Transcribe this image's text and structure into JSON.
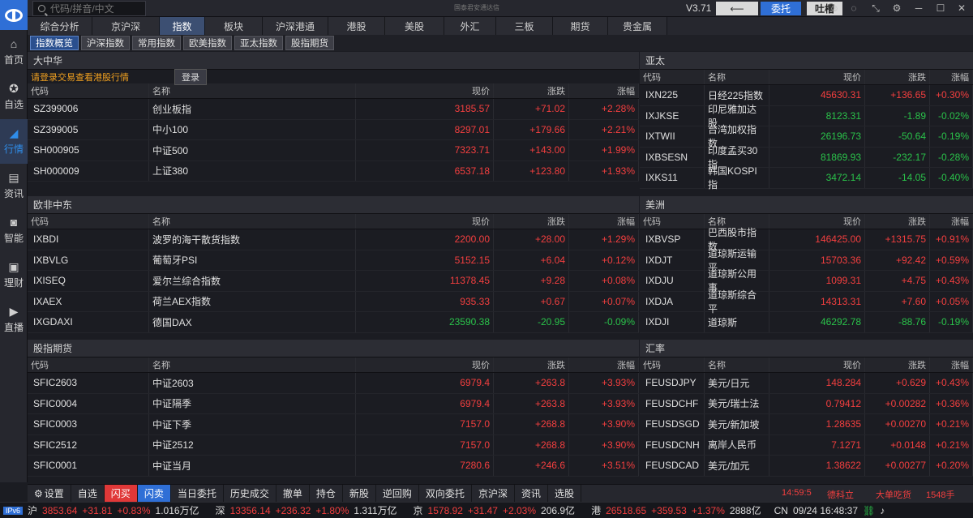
{
  "app": {
    "title_small": "国泰君安通达信",
    "version": "V3.71",
    "back_label": "",
    "entrust_label": "委托",
    "roast_label": "吐槽"
  },
  "search": {
    "placeholder": "代码/拼音/中文"
  },
  "sidebar": {
    "items": [
      {
        "label": "首页",
        "icon": "home-icon",
        "active": false
      },
      {
        "label": "自选",
        "icon": "star-icon",
        "active": false
      },
      {
        "label": "行情",
        "icon": "chart-icon",
        "active": true
      },
      {
        "label": "资讯",
        "icon": "news-icon",
        "active": false
      },
      {
        "label": "智能",
        "icon": "robot-icon",
        "active": false
      },
      {
        "label": "理财",
        "icon": "wallet-icon",
        "active": false
      },
      {
        "label": "直播",
        "icon": "video-icon",
        "active": false
      }
    ]
  },
  "nav": {
    "tabs": [
      {
        "label": "综合分析",
        "w": 80
      },
      {
        "label": "京沪深",
        "w": 83
      },
      {
        "label": "指数",
        "w": 56,
        "active": true
      },
      {
        "label": "板块",
        "w": 71
      },
      {
        "label": "沪深港通",
        "w": 81
      },
      {
        "label": "港股",
        "w": 70
      },
      {
        "label": "美股",
        "w": 73
      },
      {
        "label": "外汇",
        "w": 64
      },
      {
        "label": "三板",
        "w": 70
      },
      {
        "label": "期货",
        "w": 68
      },
      {
        "label": "贵金属",
        "w": 73
      }
    ]
  },
  "subtabs": [
    "指数概览",
    "沪深指数",
    "常用指数",
    "欧美指数",
    "亚太指数",
    "股指期货"
  ],
  "columns": {
    "code": "代码",
    "name": "名称",
    "price": "现价",
    "change": "涨跌",
    "pct": "涨幅"
  },
  "notice": {
    "text": "请登录交易查看港股行情",
    "login": "登录"
  },
  "panels": {
    "greater_china": {
      "title": "大中华",
      "rows": [
        {
          "code": "SZ399006",
          "name": "创业板指",
          "price": "3185.57",
          "change": "+71.02",
          "pct": "+2.28%",
          "dir": "up"
        },
        {
          "code": "SZ399005",
          "name": "中小100",
          "price": "8297.01",
          "change": "+179.66",
          "pct": "+2.21%",
          "dir": "up"
        },
        {
          "code": "SH000905",
          "name": "中证500",
          "price": "7323.71",
          "change": "+143.00",
          "pct": "+1.99%",
          "dir": "up"
        },
        {
          "code": "SH000009",
          "name": "上证380",
          "price": "6537.18",
          "change": "+123.80",
          "pct": "+1.93%",
          "dir": "up"
        }
      ]
    },
    "asia_pacific": {
      "title": "亚太",
      "rows": [
        {
          "code": "IXN225",
          "name": "日经225指数",
          "price": "45630.31",
          "change": "+136.65",
          "pct": "+0.30%",
          "dir": "up"
        },
        {
          "code": "IXJKSE",
          "name": "印尼雅加达股",
          "price": "8123.31",
          "change": "-1.89",
          "pct": "-0.02%",
          "dir": "down"
        },
        {
          "code": "IXTWII",
          "name": "台湾加权指数",
          "price": "26196.73",
          "change": "-50.64",
          "pct": "-0.19%",
          "dir": "down"
        },
        {
          "code": "IXBSESN",
          "name": "印度孟买30指",
          "price": "81869.93",
          "change": "-232.17",
          "pct": "-0.28%",
          "dir": "down"
        },
        {
          "code": "IXKS11",
          "name": "韩国KOSPI指",
          "price": "3472.14",
          "change": "-14.05",
          "pct": "-0.40%",
          "dir": "down"
        }
      ]
    },
    "europe_africa": {
      "title": "欧非中东",
      "rows": [
        {
          "code": "IXBDI",
          "name": "波罗的海干散货指数",
          "price": "2200.00",
          "change": "+28.00",
          "pct": "+1.29%",
          "dir": "up"
        },
        {
          "code": "IXBVLG",
          "name": "葡萄牙PSI",
          "price": "5152.15",
          "change": "+6.04",
          "pct": "+0.12%",
          "dir": "up"
        },
        {
          "code": "IXISEQ",
          "name": "爱尔兰综合指数",
          "price": "11378.45",
          "change": "+9.28",
          "pct": "+0.08%",
          "dir": "up"
        },
        {
          "code": "IXAEX",
          "name": "荷兰AEX指数",
          "price": "935.33",
          "change": "+0.67",
          "pct": "+0.07%",
          "dir": "up"
        },
        {
          "code": "IXGDAXI",
          "name": "德国DAX",
          "price": "23590.38",
          "change": "-20.95",
          "pct": "-0.09%",
          "dir": "down"
        }
      ]
    },
    "americas": {
      "title": "美洲",
      "rows": [
        {
          "code": "IXBVSP",
          "name": "巴西股市指数",
          "price": "146425.00",
          "change": "+1315.75",
          "pct": "+0.91%",
          "dir": "up"
        },
        {
          "code": "IXDJT",
          "name": "道琼斯运输平",
          "price": "15703.36",
          "change": "+92.42",
          "pct": "+0.59%",
          "dir": "up"
        },
        {
          "code": "IXDJU",
          "name": "道琼斯公用事",
          "price": "1099.31",
          "change": "+4.75",
          "pct": "+0.43%",
          "dir": "up"
        },
        {
          "code": "IXDJA",
          "name": "道琼斯综合平",
          "price": "14313.31",
          "change": "+7.60",
          "pct": "+0.05%",
          "dir": "up"
        },
        {
          "code": "IXDJI",
          "name": "道琼斯",
          "price": "46292.78",
          "change": "-88.76",
          "pct": "-0.19%",
          "dir": "down"
        }
      ]
    },
    "index_futures": {
      "title": "股指期货",
      "rows": [
        {
          "code": "SFIC2603",
          "name": "中证2603",
          "price": "6979.4",
          "change": "+263.8",
          "pct": "+3.93%",
          "dir": "up"
        },
        {
          "code": "SFIC0004",
          "name": "中证隔季",
          "price": "6979.4",
          "change": "+263.8",
          "pct": "+3.93%",
          "dir": "up"
        },
        {
          "code": "SFIC0003",
          "name": "中证下季",
          "price": "7157.0",
          "change": "+268.8",
          "pct": "+3.90%",
          "dir": "up"
        },
        {
          "code": "SFIC2512",
          "name": "中证2512",
          "price": "7157.0",
          "change": "+268.8",
          "pct": "+3.90%",
          "dir": "up"
        },
        {
          "code": "SFIC0001",
          "name": "中证当月",
          "price": "7280.6",
          "change": "+246.6",
          "pct": "+3.51%",
          "dir": "up"
        }
      ]
    },
    "fx": {
      "title": "汇率",
      "rows": [
        {
          "code": "FEUSDJPY",
          "name": "美元/日元",
          "price": "148.284",
          "change": "+0.629",
          "pct": "+0.43%",
          "dir": "up"
        },
        {
          "code": "FEUSDCHF",
          "name": "美元/瑞士法",
          "price": "0.79412",
          "change": "+0.00282",
          "pct": "+0.36%",
          "dir": "up"
        },
        {
          "code": "FEUSDSGD",
          "name": "美元/新加坡",
          "price": "1.28635",
          "change": "+0.00270",
          "pct": "+0.21%",
          "dir": "up"
        },
        {
          "code": "FEUSDCNH",
          "name": "离岸人民币",
          "price": "7.1271",
          "change": "+0.0148",
          "pct": "+0.21%",
          "dir": "up"
        },
        {
          "code": "FEUSDCAD",
          "name": "美元/加元",
          "price": "1.38622",
          "change": "+0.00277",
          "pct": "+0.20%",
          "dir": "up"
        }
      ]
    }
  },
  "bottombar": {
    "buttons": [
      {
        "label": "设置",
        "style": ""
      },
      {
        "label": "自选",
        "style": ""
      },
      {
        "label": "闪买",
        "style": "red"
      },
      {
        "label": "闪卖",
        "style": "blue"
      },
      {
        "label": "当日委托",
        "style": ""
      },
      {
        "label": "历史成交",
        "style": ""
      },
      {
        "label": "撤单",
        "style": ""
      },
      {
        "label": "持仓",
        "style": ""
      },
      {
        "label": "新股",
        "style": ""
      },
      {
        "label": "逆回购",
        "style": ""
      },
      {
        "label": "双向委托",
        "style": ""
      },
      {
        "label": "京沪深",
        "style": ""
      },
      {
        "label": "资讯",
        "style": ""
      },
      {
        "label": "选股",
        "style": ""
      }
    ],
    "time": "14:59:5",
    "stock": "德科立",
    "message": "大单吃货",
    "hands": "1548手"
  },
  "statusbar": {
    "ipv": "IPv6",
    "sh": {
      "label": "沪",
      "price": "3853.64",
      "change": "+31.81",
      "pct": "+0.83%",
      "amount": "1.016万亿"
    },
    "sz": {
      "label": "深",
      "price": "13356.14",
      "change": "+236.32",
      "pct": "+1.80%",
      "amount": "1.311万亿"
    },
    "bj": {
      "label": "京",
      "price": "1578.92",
      "change": "+31.47",
      "pct": "+2.03%",
      "amount": "206.9亿"
    },
    "hk": {
      "label": "港",
      "price": "26518.65",
      "change": "+359.53",
      "pct": "+1.37%",
      "amount": "2888亿"
    },
    "region": "CN",
    "datetime": "09/24 16:48:37"
  }
}
